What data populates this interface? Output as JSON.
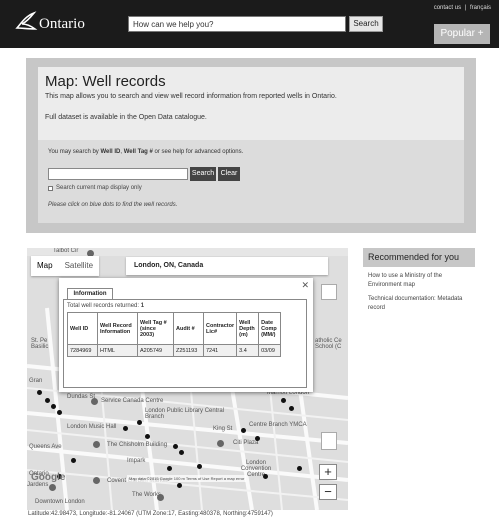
{
  "header": {
    "logo_text": "Ontario",
    "search_placeholder": "How can we help you?",
    "search_button": "Search",
    "top_links": [
      "contact us",
      "français"
    ],
    "popular_button": "Popular +"
  },
  "intro": {
    "title": "Map: Well records",
    "description": "This map allows you to search and view well record information from reported wells in Ontario.",
    "dataset_text": "Full dataset is available in the Open Data catalogue."
  },
  "search_panel": {
    "hint_prefix": "You may search by ",
    "hint_well_id": "Well ID",
    "hint_sep": ", ",
    "hint_well_tag": "Well Tag #",
    "hint_suffix": " or see help for advanced options.",
    "search_button": "Search",
    "clear_button": "Clear",
    "checkbox_label": "Search current map display only",
    "click_hint": "Please click on blue dots to find the well records."
  },
  "map": {
    "toggle_map": "Map",
    "toggle_satellite": "Satellite",
    "location": "London, ON, Canada",
    "info": {
      "tab": "Information",
      "returned_label": "Total well records returned:",
      "returned_count": "1",
      "columns": [
        "Well ID",
        "Well Record Information",
        "Well Tag # (since 2003)",
        "Audit #",
        "Contractor Lic#",
        "Well Depth (m)",
        "Date Comp (MM/)"
      ],
      "row": [
        "7284969",
        "HTML",
        "A205749",
        "Z251193",
        "7241",
        "3.4",
        "03/09"
      ]
    },
    "labels": {
      "talbot": "Talbot Cir",
      "st_peters": "St. Pe Basilic",
      "catholic": "atholic Ce School (C",
      "service_canada": "Service Canada Centre",
      "library": "London Public Library Central Branch",
      "marriott": "Marriott London",
      "music_hall": "London Music Hall",
      "ymca": "Centre Branch YMCA",
      "chisholm": "The Chisholm Building",
      "citi": "Citi Plaza",
      "impark": "Impark",
      "convention": "London Convention Centre",
      "covent": "Covent Garden Market",
      "works": "The Works",
      "downtown": "Downtown London",
      "queens": "Queens Ave",
      "dundas": "Dundas St",
      "king": "King St",
      "york": "York St",
      "ontario": "Ontario",
      "jardens": "Jardens",
      "gran": "Gran"
    },
    "google": "Google",
    "attribution": "Map data ©2015 Google   100 m   Terms of Use   Report a map error",
    "zoom_in": "+",
    "zoom_out": "−"
  },
  "coords": "Latitude:42.98473, Longitude:-81.24067 (UTM Zone:17, Easting:480378, Northing:4759147)",
  "recommended": {
    "title": "Recommended for you",
    "links": [
      "How to use a Ministry of the Environment map",
      "Technical documentation: Metadata record"
    ]
  }
}
